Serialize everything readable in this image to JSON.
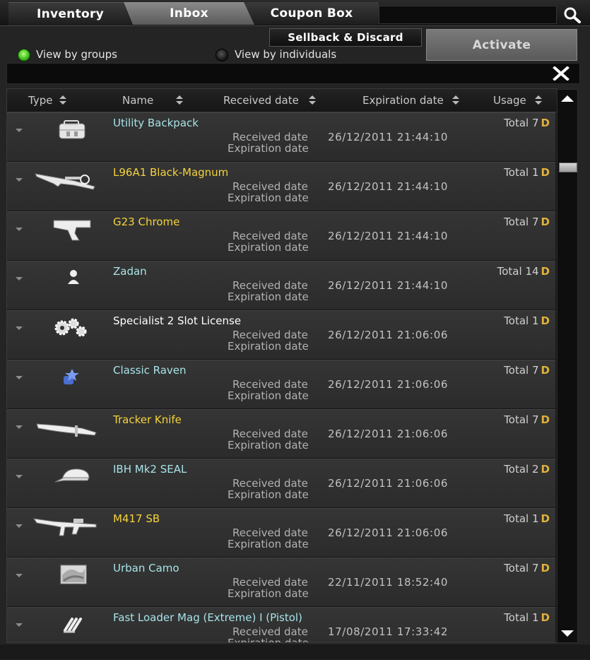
{
  "tabs": [
    {
      "label": "Inventory",
      "active": false
    },
    {
      "label": "Inbox",
      "active": true
    },
    {
      "label": "Coupon Box",
      "active": false
    }
  ],
  "search": {
    "value": ""
  },
  "toolbar": {
    "sellback_label": "Sellback & Discard",
    "activate_label": "Activate",
    "view_groups_label": "View by groups",
    "view_individuals_label": "View by individuals",
    "selected_view": "View by groups"
  },
  "table": {
    "columns": [
      "Type",
      "Name",
      "Received date",
      "Expiration date",
      "Usage"
    ],
    "received_label": "Received date",
    "expiration_label": "Expiration date",
    "total_label": "Total",
    "day_unit": "D",
    "rows": [
      {
        "icon": "backpack-icon",
        "name": "Utility Backpack",
        "name_color": "#a7e3e8",
        "received": "26/12/2011   21:44:10",
        "total": "7"
      },
      {
        "icon": "sniper-rifle-icon",
        "name": "L96A1 Black-Magnum",
        "name_color": "#f4d33c",
        "received": "26/12/2011   21:44:10",
        "total": "1"
      },
      {
        "icon": "pistol-icon",
        "name": "G23 Chrome",
        "name_color": "#f4d33c",
        "received": "26/12/2011   21:44:10",
        "total": "7"
      },
      {
        "icon": "character-icon",
        "name": "Zadan",
        "name_color": "#a7e3e8",
        "received": "26/12/2011   21:44:10",
        "total": "14"
      },
      {
        "icon": "gears-icon",
        "name": "Specialist 2 Slot License",
        "name_color": "#ffffff",
        "received": "26/12/2011   21:06:06",
        "total": "1"
      },
      {
        "icon": "rank-icon",
        "name": "Classic Raven",
        "name_color": "#a7e3e8",
        "received": "26/12/2011   21:06:06",
        "total": "7"
      },
      {
        "icon": "knife-icon",
        "name": "Tracker Knife",
        "name_color": "#f4d33c",
        "received": "26/12/2011   21:06:06",
        "total": "7"
      },
      {
        "icon": "cap-icon",
        "name": "IBH Mk2 SEAL",
        "name_color": "#a7e3e8",
        "received": "26/12/2011   21:06:06",
        "total": "2"
      },
      {
        "icon": "assault-rifle-icon",
        "name": "M417 SB",
        "name_color": "#f4d33c",
        "received": "26/12/2011   21:06:06",
        "total": "1"
      },
      {
        "icon": "camo-icon",
        "name": "Urban Camo",
        "name_color": "#a7e3e8",
        "received": "22/11/2011   18:52:40",
        "total": "7"
      },
      {
        "icon": "magazine-icon",
        "name": "Fast Loader Mag (Extreme) I (Pistol)",
        "name_color": "#a7e3e8",
        "received": "17/08/2011   17:33:42",
        "total": "1"
      }
    ]
  },
  "scrollbar": {
    "position": 0.13
  }
}
